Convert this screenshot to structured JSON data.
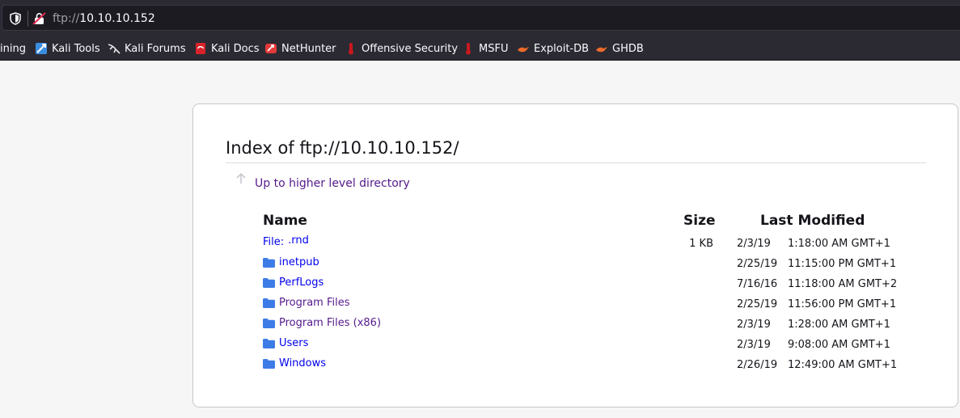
{
  "urlbar": {
    "scheme": "ftp://",
    "host": "10.10.10.152"
  },
  "bookmarks": [
    {
      "label": "ining",
      "icon": "truncated"
    },
    {
      "label": "Kali Tools",
      "icon": "kali-tools-icon"
    },
    {
      "label": "Kali Forums",
      "icon": "kali-dragon-icon"
    },
    {
      "label": "Kali Docs",
      "icon": "kali-docs-icon"
    },
    {
      "label": "NetHunter",
      "icon": "nethunter-icon"
    },
    {
      "label": "Offensive Security",
      "icon": "offsec-icon"
    },
    {
      "label": "MSFU",
      "icon": "msfu-icon"
    },
    {
      "label": "Exploit-DB",
      "icon": "exploitdb-icon"
    },
    {
      "label": "GHDB",
      "icon": "ghdb-icon"
    }
  ],
  "listing": {
    "title": "Index of ftp://10.10.10.152/",
    "up_label": "Up to higher level directory",
    "col_name": "Name",
    "col_size": "Size",
    "col_modified": "Last Modified",
    "file_prefix": "File:",
    "rows": [
      {
        "name": ".rnd",
        "type": "file",
        "size": "1 KB",
        "date": "2/3/19",
        "time": "1:18:00 AM GMT+1"
      },
      {
        "name": "inetpub",
        "type": "folder",
        "size": "",
        "date": "2/25/19",
        "time": "11:15:00 PM GMT+1"
      },
      {
        "name": "PerfLogs",
        "type": "folder",
        "size": "",
        "date": "7/16/16",
        "time": "11:18:00 AM GMT+2"
      },
      {
        "name": "Program Files",
        "type": "folder",
        "size": "",
        "date": "2/25/19",
        "time": "11:56:00 PM GMT+1"
      },
      {
        "name": "Program Files (x86)",
        "type": "folder",
        "size": "",
        "date": "2/3/19",
        "time": "1:28:00 AM GMT+1"
      },
      {
        "name": "Users",
        "type": "folder",
        "size": "",
        "date": "2/3/19",
        "time": "9:08:00 AM GMT+1"
      },
      {
        "name": "Windows",
        "type": "folder",
        "size": "",
        "date": "2/26/19",
        "time": "12:49:00 AM GMT+1"
      }
    ]
  },
  "colors": {
    "link": "#0000ee",
    "visited": "#551a8b",
    "folder": "#3d7ce6",
    "toolbar": "#2b2a33"
  }
}
